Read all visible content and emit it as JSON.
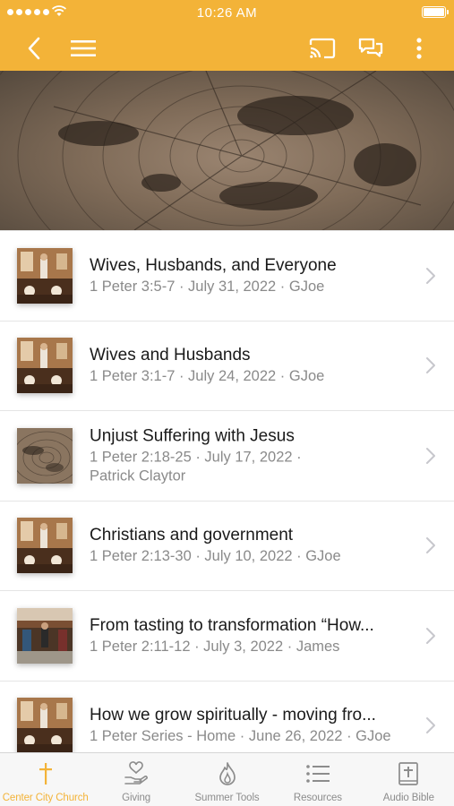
{
  "status_bar": {
    "time": "10:26 AM"
  },
  "nav": {
    "back_icon": "chevron-left-icon",
    "menu_icon": "hamburger-icon",
    "cast_icon": "cast-icon",
    "chat_icon": "chat-icon",
    "more_icon": "more-vertical-icon"
  },
  "colors": {
    "accent": "#f3b338",
    "title_text": "#1a1a1a",
    "sub_text": "#8a8a8a",
    "tab_inactive": "#8c8c8c"
  },
  "sermons": [
    {
      "title": "Wives, Husbands, and Everyone",
      "sub1": "1 Peter 3:5-7 · July 31, 2022 · GJoe",
      "sub2": "",
      "thumb": "pulpit"
    },
    {
      "title": "Wives and Husbands",
      "sub1": "1 Peter 3:1-7 · July 24, 2022 · GJoe",
      "sub2": "",
      "thumb": "pulpit"
    },
    {
      "title": "Unjust Suffering with Jesus",
      "sub1": "1 Peter 2:18-25 · July 17, 2022 ·",
      "sub2": "Patrick Claytor",
      "thumb": "wood"
    },
    {
      "title": "Christians and government",
      "sub1": "1 Peter 2:13-30 · July 10, 2022 · GJoe",
      "sub2": "",
      "thumb": "pulpit"
    },
    {
      "title": "From tasting to transformation  “How...",
      "sub1": "1 Peter 2:11-12 · July 3, 2022 · James",
      "sub2": "",
      "thumb": "stage"
    },
    {
      "title": "How we grow spiritually - moving fro...",
      "sub1": "1 Peter Series - Home · June 26, 2022 · GJoe",
      "sub2": "",
      "thumb": "pulpit"
    }
  ],
  "tabs": [
    {
      "label": "Center City Church",
      "icon": "cross-icon",
      "active": true
    },
    {
      "label": "Giving",
      "icon": "giving-hand-icon",
      "active": false
    },
    {
      "label": "Summer Tools",
      "icon": "flame-icon",
      "active": false
    },
    {
      "label": "Resources",
      "icon": "list-icon",
      "active": false
    },
    {
      "label": "Audio Bible",
      "icon": "bible-icon",
      "active": false
    }
  ]
}
